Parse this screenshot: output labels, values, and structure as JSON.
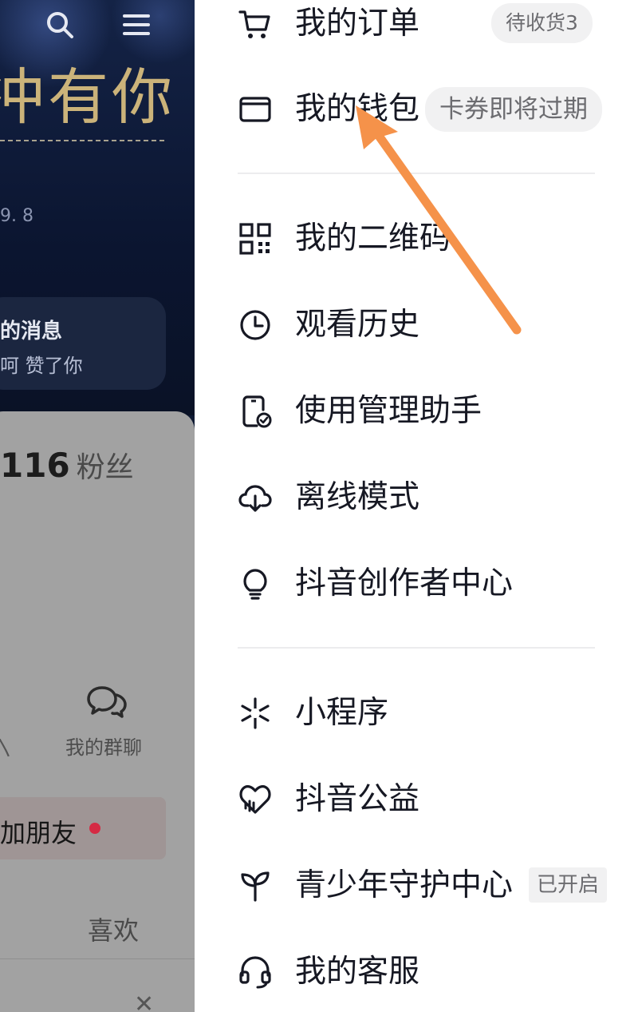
{
  "left_page": {
    "banner_text": "冲有你",
    "id_text": "9. 8",
    "notice": {
      "title": "的消息",
      "sub": "呵 赞了你"
    },
    "fans": {
      "count": "116",
      "label": "粉丝"
    },
    "group_label": "我的群聊",
    "add_friends_label": "加朋友",
    "likes_tab": "喜欢"
  },
  "menu": {
    "orders": {
      "label": "我的订单",
      "badge": "待收货3"
    },
    "wallet": {
      "label": "我的钱包",
      "badge": "卡券即将过期"
    },
    "qrcode": {
      "label": "我的二维码"
    },
    "history": {
      "label": "观看历史"
    },
    "manage": {
      "label": "使用管理助手"
    },
    "offline": {
      "label": "离线模式"
    },
    "creator": {
      "label": "抖音创作者中心"
    },
    "miniapp": {
      "label": "小程序"
    },
    "charity": {
      "label": "抖音公益"
    },
    "youth": {
      "label": "青少年守护中心",
      "badge": "已开启"
    },
    "service": {
      "label": "我的客服"
    }
  },
  "colors": {
    "arrow": "#f5924a",
    "text": "#161823",
    "badge_bg": "#f1f1f2"
  }
}
